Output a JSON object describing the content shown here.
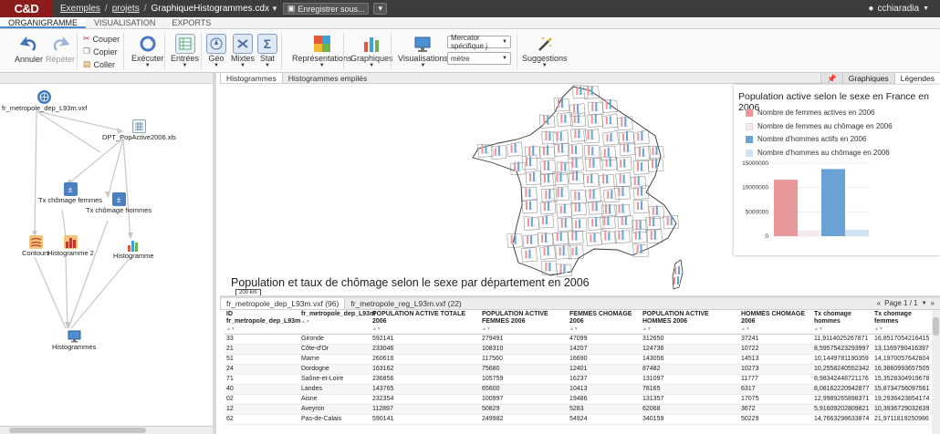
{
  "app": {
    "logo": "C&D",
    "breadcrumb": [
      "Exemples",
      "projets"
    ],
    "current_file": "GraphiqueHistogrammes.cdx",
    "save_label": "Enregistrer sous...",
    "more_label": "▾",
    "user": "cchiaradia"
  },
  "menu_tabs": [
    "ORGANIGRAMME",
    "VISUALISATION",
    "EXPORTS"
  ],
  "ribbon": {
    "undo": "Annuler",
    "redo": "Répéter",
    "cut": "Couper",
    "copy": "Copier",
    "paste": "Coller",
    "execute": "Exécuter",
    "inputs": "Entrées",
    "geo": "Géo",
    "mixed": "Mixtes",
    "stat": "Stat",
    "representations": "Représentations",
    "graphics": "Graphiques",
    "visualisations": "Visualisations",
    "projection_select": "Mercator spécifique j",
    "unit_select": "mètre",
    "suggestions": "Suggestions"
  },
  "flow_nodes": [
    {
      "id": "fr_metropole_dep_L93m.vxf"
    },
    {
      "id": "DPT_PopActive2006.xls"
    },
    {
      "id": "Tx chômage femmes"
    },
    {
      "id": "Tx chômage hommes"
    },
    {
      "id": "Contours"
    },
    {
      "id": "Histogramme 2"
    },
    {
      "id": "Histogramme"
    },
    {
      "id": "Histogrammes"
    }
  ],
  "view_tabs": [
    "Histogrammes",
    "Histogrammes empilés"
  ],
  "side_tabs": [
    "Graphiques",
    "Légendes"
  ],
  "map": {
    "title": "Population et taux de chômage selon le sexe par département en 2006",
    "scale_label": "200 km"
  },
  "legend": {
    "title": "Population active selon le sexe en France en 2006",
    "entries": [
      {
        "label": "Nombre de femmes actives en 2006",
        "color": "#e8979a"
      },
      {
        "label": "Nombre de femmes au chômage en 2006",
        "color": "#f6eaea"
      },
      {
        "label": "Nombre d'hommes actifs en 2006",
        "color": "#6aa2d6"
      },
      {
        "label": "Nombre d'hommes au chômage en 2006",
        "color": "#cfe3f4"
      }
    ]
  },
  "chart_data": {
    "type": "bar",
    "categories": [
      "Nombre de femmes actives en 2006",
      "Nombre de femmes au chômage en 2006",
      "Nombre d'hommes actifs en 2006",
      "Nombre d'hommes au chômage en 2006"
    ],
    "values": [
      11600000,
      1200000,
      13800000,
      1300000
    ],
    "colors": [
      "#e8979a",
      "#f6eaea",
      "#6aa2d6",
      "#cfe3f4"
    ],
    "yticks": [
      "15000000",
      "10000000",
      "5000000",
      "0"
    ],
    "ylim": [
      0,
      15000000
    ]
  },
  "data_tabs": [
    "fr_metropole_dep_L93m.vxf (96)",
    "fr_metropole_reg_L93m.vxf (22)"
  ],
  "pager": {
    "prev": "«",
    "label": "Page 1 / 1",
    "next": "»"
  },
  "table": {
    "headers": [
      "ID fr_metropole_dep_L93m",
      "fr_metropole_dep_L93m",
      "POPULATION ACTIVE TOTALE 2006",
      "POPULATION ACTIVE FEMMES 2006",
      "FEMMES CHOMAGE 2006",
      "POPULATION ACTIVE HOMMES 2006",
      "HOMMES CHOMAGE 2006",
      "Tx chomage hommes",
      "Tx chomage femmes"
    ],
    "rows": [
      [
        "33",
        "Gironde",
        "592141",
        "279491",
        "47099",
        "312650",
        "37241",
        "11,9114025267871",
        "16,8517054216415"
      ],
      [
        "21",
        "Côte-d'Or",
        "233046",
        "108310",
        "14207",
        "124736",
        "10722",
        "8,59575423293997",
        "13,1169790416397"
      ],
      [
        "51",
        "Marne",
        "260616",
        "117560",
        "16690",
        "143056",
        "14513",
        "10,1449781190359",
        "14,1970057642804"
      ],
      [
        "24",
        "Dordogne",
        "163162",
        "75680",
        "12401",
        "87482",
        "10273",
        "10,2558240552342",
        "16,3860993657505"
      ],
      [
        "71",
        "Saône-et-Loire",
        "236856",
        "105759",
        "16237",
        "131097",
        "11777",
        "8,98342448721176",
        "15,3528304919678"
      ],
      [
        "40",
        "Landes",
        "143765",
        "65600",
        "10413",
        "78165",
        "6317",
        "8,08162220942877",
        "15,8734756097561"
      ],
      [
        "02",
        "Aisne",
        "232354",
        "100997",
        "19486",
        "131357",
        "17075",
        "12,9989265898371",
        "19,2936423854174"
      ],
      [
        "12",
        "Aveyron",
        "112897",
        "50829",
        "5283",
        "62068",
        "3672",
        "5,91609202809821",
        "10,3936729032639"
      ],
      [
        "62",
        "Pas-de-Calais",
        "590141",
        "249982",
        "54924",
        "340159",
        "50229",
        "14,7663298633874",
        "21,9711819250986"
      ]
    ]
  }
}
